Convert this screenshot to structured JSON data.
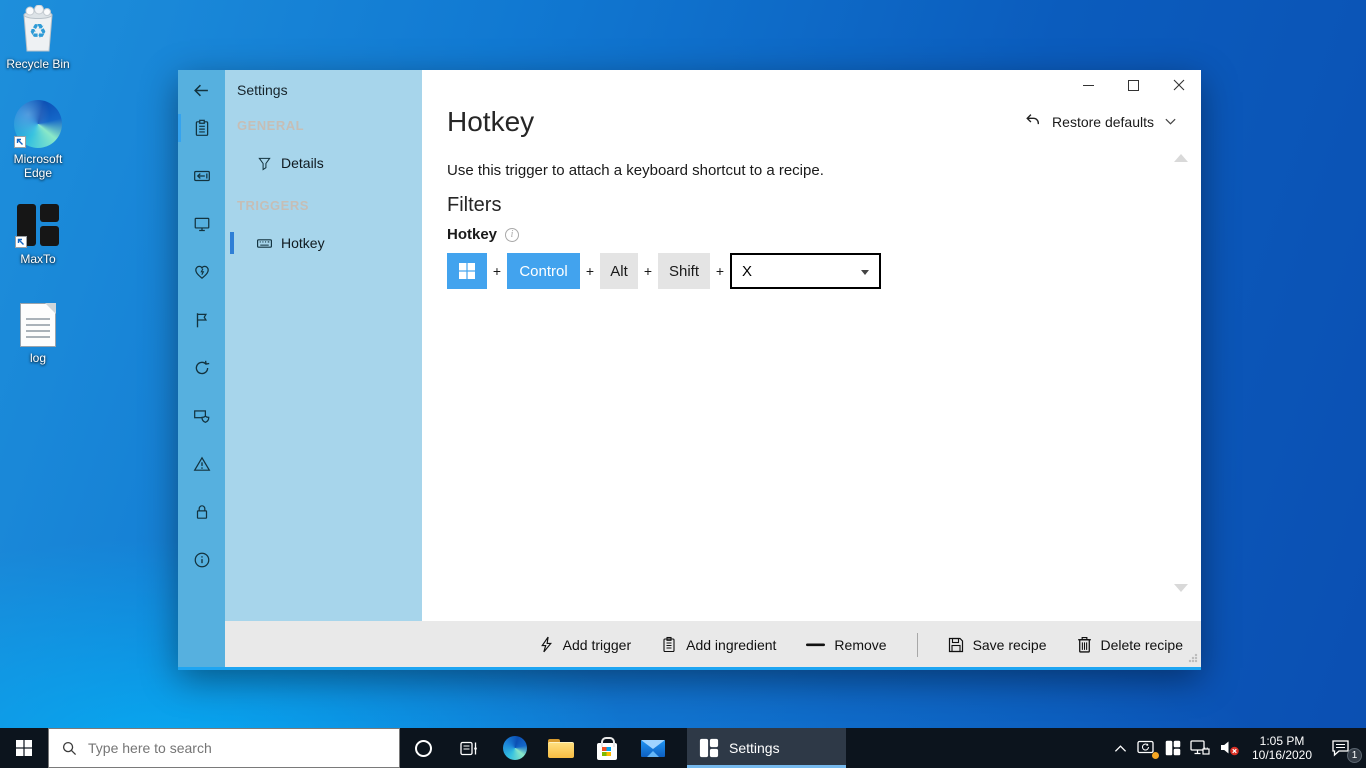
{
  "colors": {
    "accent_blue": "#42a3ee",
    "rail_blue": "#56b0df",
    "panel_blue": "#a7d5eb",
    "nav_selected_bar": "#2f7fd6",
    "taskbar_dark": "#0c141d",
    "active_task_underline": "#76b9ed",
    "window_bottom_glow": "#1ea5f2"
  },
  "desktop": {
    "recycle_glyph": "♻",
    "icons": [
      {
        "name": "recycle-bin",
        "label": "Recycle Bin"
      },
      {
        "name": "microsoft-edge",
        "label": "Microsoft Edge"
      },
      {
        "name": "maxto",
        "label": "MaxTo"
      },
      {
        "name": "log",
        "label": "log"
      }
    ]
  },
  "window": {
    "nav_rail_icons": [
      "back-arrow-icon",
      "clipboard-icon",
      "input-box-icon",
      "monitor-icon",
      "heart-pulse-icon",
      "flag-icon",
      "refresh-icon",
      "window-shield-icon",
      "warning-triangle-icon",
      "lock-icon",
      "info-icon"
    ],
    "nav_rail_selected": "clipboard-icon",
    "nav_panel": {
      "title": "Settings",
      "sections": [
        {
          "header": "GENERAL",
          "items": [
            {
              "label": "Details",
              "icon": "funnel-icon",
              "selected": false
            }
          ]
        },
        {
          "header": "TRIGGERS",
          "items": [
            {
              "label": "Hotkey",
              "icon": "keyboard-icon",
              "selected": true
            }
          ]
        }
      ]
    },
    "content": {
      "title": "Hotkey",
      "description": "Use this trigger to attach a keyboard shortcut to a recipe.",
      "filters_heading": "Filters",
      "field_label": "Hotkey",
      "info_glyph": "i",
      "restore_defaults_label": "Restore defaults",
      "hotkey": {
        "separator": "+",
        "modifiers": [
          {
            "icon": "windows-logo-icon",
            "active": true
          },
          {
            "label": "Control",
            "active": true
          },
          {
            "label": "Alt",
            "active": false
          },
          {
            "label": "Shift",
            "active": false
          }
        ],
        "key": "X"
      }
    },
    "toolbar": {
      "items": [
        {
          "label": "Add trigger",
          "icon": "lightning-icon"
        },
        {
          "label": "Add ingredient",
          "icon": "clipboard-icon"
        },
        {
          "label": "Remove",
          "icon": "dash-icon"
        },
        {
          "label": "Save recipe",
          "icon": "save-icon"
        },
        {
          "label": "Delete recipe",
          "icon": "trash-icon"
        }
      ]
    }
  },
  "taskbar": {
    "search": {
      "placeholder": "Type here to search"
    },
    "icons": [
      "start-icon",
      "cortana-icon",
      "task-view-icon",
      "edge-icon",
      "file-explorer-icon",
      "store-icon",
      "mail-icon"
    ],
    "active_task": {
      "label": "Settings",
      "icon": "maxto-icon"
    },
    "tray": {
      "icons": [
        "tray-chevron-icon",
        "update-icon",
        "maxto-tray-icon",
        "network-icon",
        "volume-muted-icon",
        "action-center-icon"
      ],
      "time": "1:05 PM",
      "date": "10/16/2020",
      "notification_badge": "1"
    }
  }
}
